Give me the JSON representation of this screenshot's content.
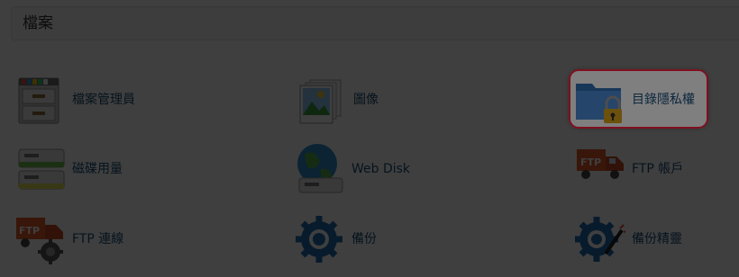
{
  "section": {
    "title": "檔案"
  },
  "items": [
    {
      "label": "檔案管理員",
      "icon": "file-cabinet-icon"
    },
    {
      "label": "圖像",
      "icon": "images-icon"
    },
    {
      "label": "目錄隱私權",
      "icon": "folder-lock-icon"
    },
    {
      "label": "磁碟用量",
      "icon": "disk-drives-icon"
    },
    {
      "label": "Web Disk",
      "icon": "globe-drive-icon"
    },
    {
      "label": "FTP 帳戶",
      "icon": "ftp-truck-icon"
    },
    {
      "label": "FTP 連線",
      "icon": "ftp-truck-gear-icon"
    },
    {
      "label": "備份",
      "icon": "backup-gear-icon"
    },
    {
      "label": "備份精靈",
      "icon": "backup-wizard-gear-icon"
    }
  ],
  "colors": {
    "highlight_border": "#ff1f3f",
    "label_text": "#1a4f7a",
    "dim_overlay": "rgba(0,0,0,0.5)"
  }
}
